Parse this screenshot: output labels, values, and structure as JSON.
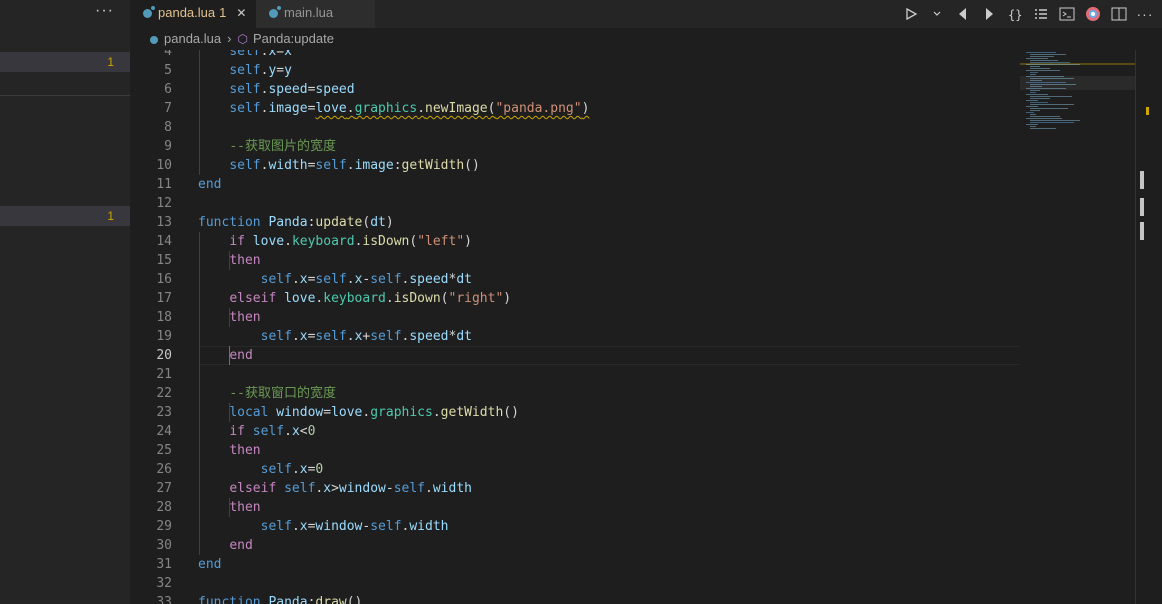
{
  "sidebar": {
    "more_label": "···",
    "rows": [
      {
        "count": "1",
        "active": true
      },
      {
        "count": "1",
        "active": true
      }
    ]
  },
  "tabs": [
    {
      "label": "panda.lua",
      "badge": "1",
      "close": "✕",
      "active": true,
      "modified_color": "#e2c08d"
    },
    {
      "label": "main.lua",
      "active": false
    }
  ],
  "toolbar": {
    "icons": [
      "run-icon",
      "go-back-icon",
      "go-forward-icon",
      "braces-icon",
      "list-icon",
      "terminal-icon",
      "extension-icon",
      "split-editor-icon",
      "more-icon"
    ]
  },
  "breadcrumb": {
    "file": "panda.lua",
    "symbol": "Panda:update"
  },
  "editor": {
    "current_line": "20",
    "lines": [
      {
        "n": "4",
        "tokens": [
          [
            "    ",
            ""
          ],
          [
            "self",
            ".t-kw"
          ],
          [
            ".",
            ""
          ],
          [
            "x",
            "t-var"
          ],
          [
            "=",
            ""
          ],
          [
            "x",
            "t-var"
          ]
        ]
      },
      {
        "n": "5",
        "tokens": [
          [
            "    ",
            ""
          ],
          [
            "self",
            "t-kw"
          ],
          [
            ".",
            ""
          ],
          [
            "y",
            "t-var"
          ],
          [
            "=",
            ""
          ],
          [
            "y",
            "t-var"
          ]
        ]
      },
      {
        "n": "6",
        "tokens": [
          [
            "    ",
            ""
          ],
          [
            "self",
            "t-kw"
          ],
          [
            ".",
            ""
          ],
          [
            "speed",
            "t-var"
          ],
          [
            "=",
            ""
          ],
          [
            "speed",
            "t-var"
          ]
        ]
      },
      {
        "n": "7",
        "tokens": [
          [
            "    ",
            ""
          ],
          [
            "self",
            "t-kw"
          ],
          [
            ".",
            ""
          ],
          [
            "image",
            "t-var"
          ],
          [
            "=",
            ""
          ],
          [
            "love.graphics.newImage(\"panda.png\")",
            "squig-line"
          ]
        ]
      },
      {
        "n": "8",
        "tokens": []
      },
      {
        "n": "9",
        "tokens": [
          [
            "    ",
            ""
          ],
          [
            "--获取图片的宽度",
            "t-cm"
          ]
        ]
      },
      {
        "n": "10",
        "tokens": [
          [
            "    ",
            ""
          ],
          [
            "self",
            "t-kw"
          ],
          [
            ".",
            ""
          ],
          [
            "width",
            "t-var"
          ],
          [
            "=",
            ""
          ],
          [
            "self",
            "t-kw"
          ],
          [
            ".",
            ""
          ],
          [
            "image",
            "t-var"
          ],
          [
            ":",
            ""
          ],
          [
            "getWidth",
            "t-fn"
          ],
          [
            "()",
            ""
          ]
        ]
      },
      {
        "n": "11",
        "tokens": [
          [
            "end",
            "t-kw"
          ]
        ]
      },
      {
        "n": "12",
        "tokens": []
      },
      {
        "n": "13",
        "tokens": [
          [
            "function",
            "t-kw"
          ],
          [
            " ",
            ""
          ],
          [
            "Panda",
            "t-var"
          ],
          [
            ":",
            ""
          ],
          [
            "update",
            "t-fn"
          ],
          [
            "(",
            ""
          ],
          [
            "dt",
            "t-var"
          ],
          [
            ")",
            ""
          ]
        ]
      },
      {
        "n": "14",
        "tokens": [
          [
            "    ",
            ""
          ],
          [
            "if",
            "t-ctl"
          ],
          [
            " ",
            ""
          ],
          [
            "love",
            "t-var"
          ],
          [
            ".",
            ""
          ],
          [
            "keyboard",
            "t-lib"
          ],
          [
            ".",
            ""
          ],
          [
            "isDown",
            "t-fn"
          ],
          [
            "(",
            ""
          ],
          [
            "\"left\"",
            "t-str"
          ],
          [
            ")",
            ""
          ]
        ]
      },
      {
        "n": "15",
        "tokens": [
          [
            "    ",
            ""
          ],
          [
            "then",
            "t-ctl"
          ]
        ]
      },
      {
        "n": "16",
        "tokens": [
          [
            "        ",
            ""
          ],
          [
            "self",
            "t-kw"
          ],
          [
            ".",
            ""
          ],
          [
            "x",
            "t-var"
          ],
          [
            "=",
            ""
          ],
          [
            "self",
            "t-kw"
          ],
          [
            ".",
            ""
          ],
          [
            "x",
            "t-var"
          ],
          [
            "-",
            ""
          ],
          [
            "self",
            "t-kw"
          ],
          [
            ".",
            ""
          ],
          [
            "speed",
            "t-var"
          ],
          [
            "*",
            ""
          ],
          [
            "dt",
            "t-var"
          ]
        ]
      },
      {
        "n": "17",
        "tokens": [
          [
            "    ",
            ""
          ],
          [
            "elseif",
            "t-ctl"
          ],
          [
            " ",
            ""
          ],
          [
            "love",
            "t-var"
          ],
          [
            ".",
            ""
          ],
          [
            "keyboard",
            "t-lib"
          ],
          [
            ".",
            ""
          ],
          [
            "isDown",
            "t-fn"
          ],
          [
            "(",
            ""
          ],
          [
            "\"right\"",
            "t-str"
          ],
          [
            ")",
            ""
          ]
        ]
      },
      {
        "n": "18",
        "tokens": [
          [
            "    ",
            ""
          ],
          [
            "then",
            "t-ctl"
          ]
        ]
      },
      {
        "n": "19",
        "tokens": [
          [
            "        ",
            ""
          ],
          [
            "self",
            "t-kw"
          ],
          [
            ".",
            ""
          ],
          [
            "x",
            "t-var"
          ],
          [
            "=",
            ""
          ],
          [
            "self",
            "t-kw"
          ],
          [
            ".",
            ""
          ],
          [
            "x",
            "t-var"
          ],
          [
            "+",
            ""
          ],
          [
            "self",
            "t-kw"
          ],
          [
            ".",
            ""
          ],
          [
            "speed",
            "t-var"
          ],
          [
            "*",
            ""
          ],
          [
            "dt",
            "t-var"
          ]
        ]
      },
      {
        "n": "20",
        "tokens": [
          [
            "    ",
            ""
          ],
          [
            "end",
            "t-ctl"
          ]
        ]
      },
      {
        "n": "21",
        "tokens": []
      },
      {
        "n": "22",
        "tokens": [
          [
            "    ",
            ""
          ],
          [
            "--获取窗口的宽度",
            "t-cm"
          ]
        ]
      },
      {
        "n": "23",
        "tokens": [
          [
            "    ",
            ""
          ],
          [
            "local",
            "t-kw"
          ],
          [
            " ",
            ""
          ],
          [
            "window",
            "t-var"
          ],
          [
            "=",
            ""
          ],
          [
            "love",
            "t-var"
          ],
          [
            ".",
            ""
          ],
          [
            "graphics",
            "t-lib"
          ],
          [
            ".",
            ""
          ],
          [
            "getWidth",
            "t-fn"
          ],
          [
            "()",
            ""
          ]
        ]
      },
      {
        "n": "24",
        "tokens": [
          [
            "    ",
            ""
          ],
          [
            "if",
            "t-ctl"
          ],
          [
            " ",
            ""
          ],
          [
            "self",
            "t-kw"
          ],
          [
            ".",
            ""
          ],
          [
            "x",
            "t-var"
          ],
          [
            "<",
            ""
          ],
          [
            "0",
            "t-num"
          ]
        ]
      },
      {
        "n": "25",
        "tokens": [
          [
            "    ",
            ""
          ],
          [
            "then",
            "t-ctl"
          ]
        ]
      },
      {
        "n": "26",
        "tokens": [
          [
            "        ",
            ""
          ],
          [
            "self",
            "t-kw"
          ],
          [
            ".",
            ""
          ],
          [
            "x",
            "t-var"
          ],
          [
            "=",
            ""
          ],
          [
            "0",
            "t-num"
          ]
        ]
      },
      {
        "n": "27",
        "tokens": [
          [
            "    ",
            ""
          ],
          [
            "elseif",
            "t-ctl"
          ],
          [
            " ",
            ""
          ],
          [
            "self",
            "t-kw"
          ],
          [
            ".",
            ""
          ],
          [
            "x",
            "t-var"
          ],
          [
            ">",
            ""
          ],
          [
            "window",
            "t-var"
          ],
          [
            "-",
            ""
          ],
          [
            "self",
            "t-kw"
          ],
          [
            ".",
            ""
          ],
          [
            "width",
            "t-var"
          ]
        ]
      },
      {
        "n": "28",
        "tokens": [
          [
            "    ",
            ""
          ],
          [
            "then",
            "t-ctl"
          ]
        ]
      },
      {
        "n": "29",
        "tokens": [
          [
            "        ",
            ""
          ],
          [
            "self",
            "t-kw"
          ],
          [
            ".",
            ""
          ],
          [
            "x",
            "t-var"
          ],
          [
            "=",
            ""
          ],
          [
            "window",
            "t-var"
          ],
          [
            "-",
            ""
          ],
          [
            "self",
            "t-kw"
          ],
          [
            ".",
            ""
          ],
          [
            "width",
            "t-var"
          ]
        ]
      },
      {
        "n": "30",
        "tokens": [
          [
            "    ",
            ""
          ],
          [
            "end",
            "t-ctl"
          ]
        ]
      },
      {
        "n": "31",
        "tokens": [
          [
            "end",
            "t-kw"
          ]
        ]
      },
      {
        "n": "32",
        "tokens": []
      },
      {
        "n": "33",
        "tokens": [
          [
            "function",
            "t-kw"
          ],
          [
            " ",
            ""
          ],
          [
            "Panda",
            "t-var"
          ],
          [
            ":",
            ""
          ],
          [
            "draw",
            "t-fn"
          ],
          [
            "()",
            ""
          ]
        ]
      }
    ]
  },
  "colors": {
    "warning": "#cca700",
    "accent": "#519aba"
  }
}
